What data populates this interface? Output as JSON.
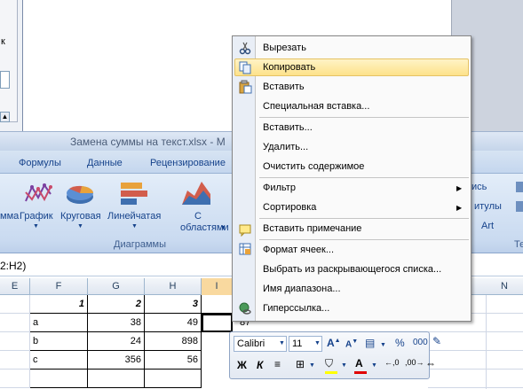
{
  "background_window": {
    "label_k": "к"
  },
  "title": "Замена суммы на текст.xlsx - М",
  "ribbon": {
    "tabs": [
      "Формулы",
      "Данные",
      "Рецензирование"
    ],
    "chart_buttons": [
      {
        "label": "мма"
      },
      {
        "label": "График"
      },
      {
        "label": "Круговая"
      },
      {
        "label": "Линейчатая"
      },
      {
        "label": "С",
        "label2": "областями"
      }
    ],
    "group_label": "Диаграммы",
    "right_items": [
      "ись",
      "итулы",
      "Art",
      "Те"
    ]
  },
  "formula_bar": {
    "text": "2:H2)"
  },
  "columns": [
    "E",
    "F",
    "G",
    "H",
    "I",
    "N"
  ],
  "rows": [
    {
      "f": "1",
      "g": "2",
      "h": "3",
      "i": ""
    },
    {
      "f": "a",
      "g": "38",
      "h": "49",
      "i": "87"
    },
    {
      "f": "b",
      "g": "24",
      "h": "898",
      "i": ""
    },
    {
      "f": "c",
      "g": "356",
      "h": "56",
      "i": ""
    },
    {
      "f": "",
      "g": "",
      "h": "",
      "i": ""
    }
  ],
  "context_menu": {
    "items": [
      {
        "label": "Вырезать",
        "icon": "scissors-icon"
      },
      {
        "label": "Копировать",
        "icon": "copy-icon",
        "highlighted": true
      },
      {
        "label": "Вставить",
        "icon": "paste-icon"
      },
      {
        "label": "Специальная вставка..."
      },
      {
        "label": "Вставить..."
      },
      {
        "label": "Удалить..."
      },
      {
        "label": "Очистить содержимое"
      },
      {
        "label": "Фильтр",
        "submenu": true
      },
      {
        "label": "Сортировка",
        "submenu": true
      },
      {
        "label": "Вставить примечание",
        "icon": "comment-icon"
      },
      {
        "label": "Формат ячеек...",
        "icon": "format-cells-icon"
      },
      {
        "label": "Выбрать из раскрывающегося списка..."
      },
      {
        "label": "Имя диапазона..."
      },
      {
        "label": "Гиперссылка...",
        "icon": "hyperlink-icon"
      }
    ]
  },
  "mini_toolbar": {
    "font": "Calibri",
    "size": "11",
    "bold": "Ж",
    "italic": "К",
    "percent": "%",
    "thousands": "000"
  }
}
